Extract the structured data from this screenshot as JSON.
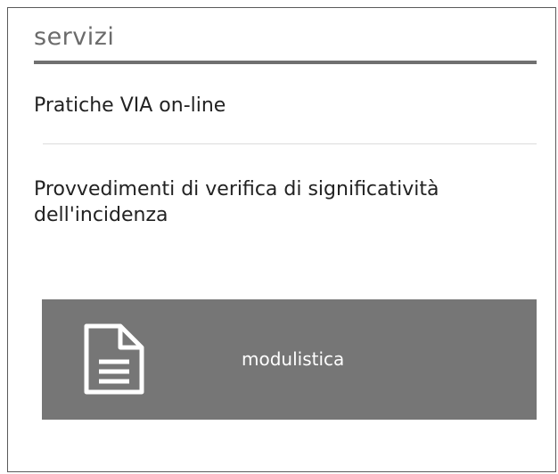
{
  "section": {
    "title": "servizi"
  },
  "links": [
    {
      "label": "Pratiche VIA on-line"
    },
    {
      "label": "Provvedimenti di verifica di significatività dell'incidenza"
    }
  ],
  "tile": {
    "label": "modulistica",
    "icon": "document-icon",
    "background": "#767676"
  },
  "colors": {
    "title": "#6b6b6b",
    "title_rule": "#707070",
    "item_rule": "#dcdcdc",
    "text": "#222222",
    "tile_text": "#ffffff"
  }
}
